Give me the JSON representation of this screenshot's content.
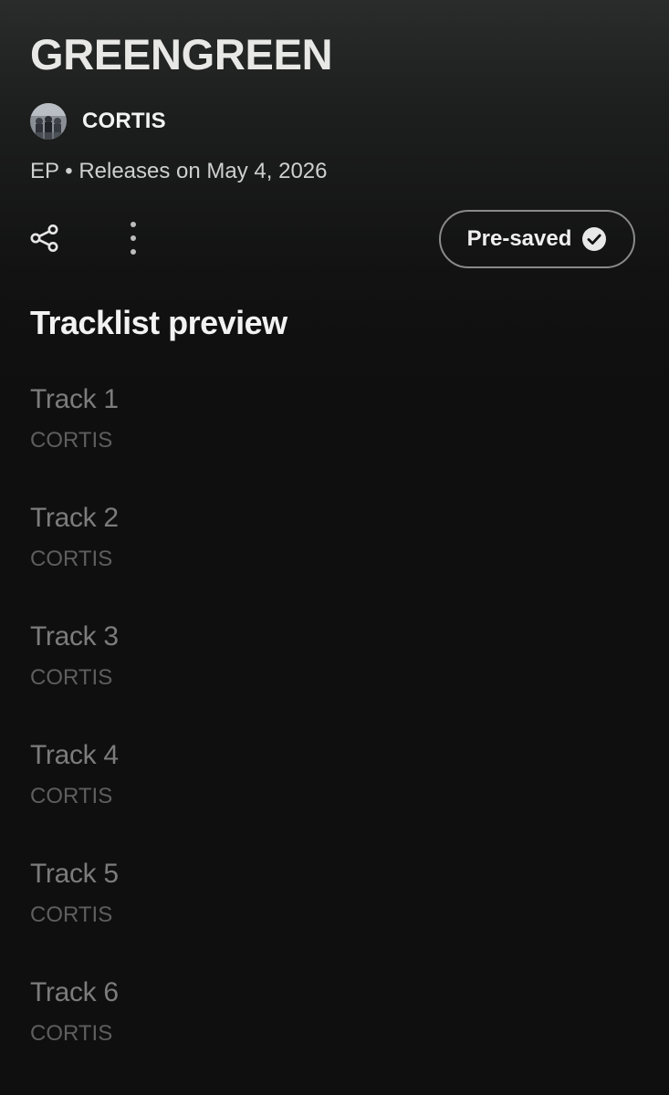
{
  "album": {
    "title": "GREENGREEN",
    "artist": "CORTIS",
    "release_info": "EP • Releases on May 4, 2026"
  },
  "actions": {
    "share_icon": "share-icon",
    "more_icon": "more-vertical-icon",
    "presave_label": "Pre-saved",
    "presave_icon": "check-circle-icon"
  },
  "section": {
    "title": "Tracklist preview"
  },
  "tracks": [
    {
      "title": "Track 1",
      "artist": "CORTIS"
    },
    {
      "title": "Track 2",
      "artist": "CORTIS"
    },
    {
      "title": "Track 3",
      "artist": "CORTIS"
    },
    {
      "title": "Track 4",
      "artist": "CORTIS"
    },
    {
      "title": "Track 5",
      "artist": "CORTIS"
    },
    {
      "title": "Track 6",
      "artist": "CORTIS"
    }
  ],
  "colors": {
    "background": "#0f0f0f",
    "header_gradient_top": "#2a2c2b",
    "title_text": "#e8e8e6",
    "track_title": "#7c7c7c",
    "track_artist": "#5e5e5e",
    "button_border": "#8a8a8a"
  }
}
